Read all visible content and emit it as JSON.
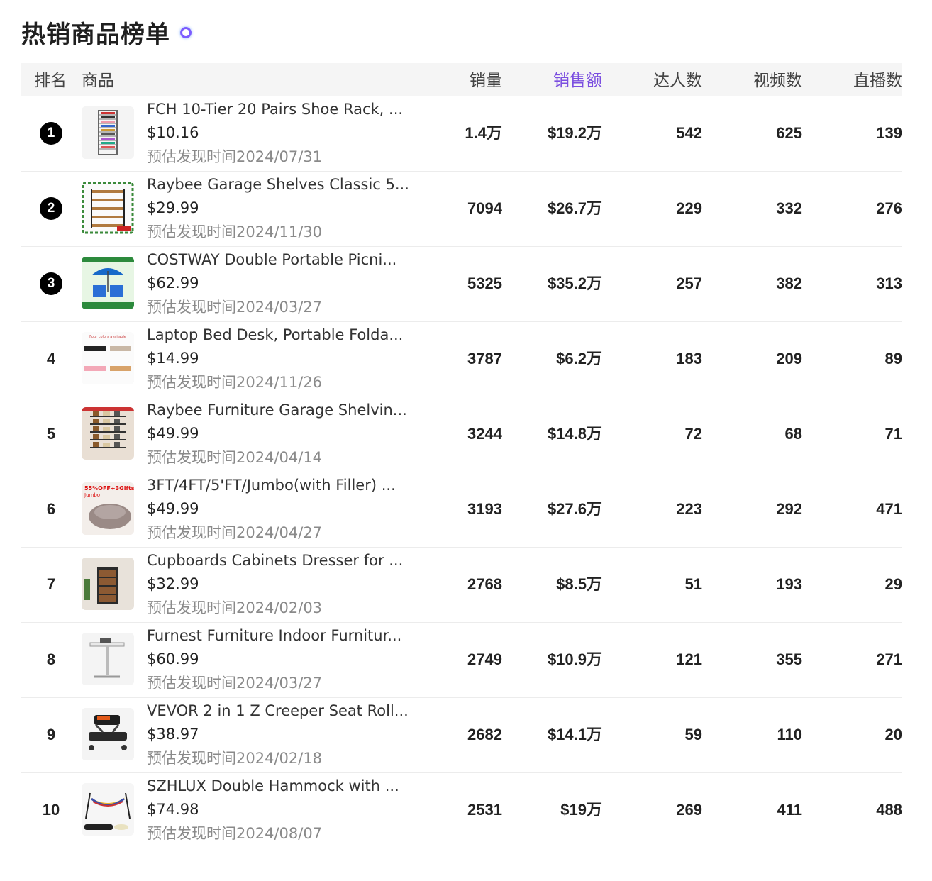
{
  "page": {
    "title": "热销商品榜单",
    "loading_icon": "spinner-icon",
    "accent_color": "#7b4fe0"
  },
  "table": {
    "headers": {
      "rank": "排名",
      "product": "商品",
      "sales": "销量",
      "revenue": "销售额",
      "creators": "达人数",
      "videos": "视频数",
      "live": "直播数"
    },
    "rows": [
      {
        "rank": "1",
        "name": "FCH 10-Tier 20 Pairs Shoe Rack, ...",
        "price": "$10.16",
        "date": "预估发现时间2024/07/31",
        "sales": "1.4万",
        "revenue": "$19.2万",
        "creators": "542",
        "videos": "625",
        "live": "139",
        "thumb": "shoe-rack-icon"
      },
      {
        "rank": "2",
        "name": "Raybee Garage Shelves Classic 5...",
        "price": "$29.99",
        "date": "预估发现时间2024/11/30",
        "sales": "7094",
        "revenue": "$26.7万",
        "creators": "229",
        "videos": "332",
        "live": "276",
        "thumb": "garage-shelf-icon"
      },
      {
        "rank": "3",
        "name": "COSTWAY Double Portable Picni...",
        "price": "$62.99",
        "date": "预估发现时间2024/03/27",
        "sales": "5325",
        "revenue": "$35.2万",
        "creators": "257",
        "videos": "382",
        "live": "313",
        "thumb": "picnic-chair-icon"
      },
      {
        "rank": "4",
        "name": "Laptop Bed Desk, Portable Folda...",
        "price": "$14.99",
        "date": "预估发现时间2024/11/26",
        "sales": "3787",
        "revenue": "$6.2万",
        "creators": "183",
        "videos": "209",
        "live": "89",
        "thumb": "laptop-desk-icon"
      },
      {
        "rank": "5",
        "name": "Raybee Furniture Garage Shelvin...",
        "price": "$49.99",
        "date": "预估发现时间2024/04/14",
        "sales": "3244",
        "revenue": "$14.8万",
        "creators": "72",
        "videos": "68",
        "live": "71",
        "thumb": "shelving-icon"
      },
      {
        "rank": "6",
        "name": "3FT/4FT/5'FT/Jumbo(with Filler) ...",
        "price": "$49.99",
        "date": "预估发现时间2024/04/27",
        "sales": "3193",
        "revenue": "$27.6万",
        "creators": "223",
        "videos": "292",
        "live": "471",
        "thumb": "bean-bag-icon"
      },
      {
        "rank": "7",
        "name": "Cupboards Cabinets Dresser for ...",
        "price": "$32.99",
        "date": "预估发现时间2024/02/03",
        "sales": "2768",
        "revenue": "$8.5万",
        "creators": "51",
        "videos": "193",
        "live": "29",
        "thumb": "dresser-icon"
      },
      {
        "rank": "8",
        "name": "Furnest Furniture Indoor Furnitur...",
        "price": "$60.99",
        "date": "预估发现时间2024/03/27",
        "sales": "2749",
        "revenue": "$10.9万",
        "creators": "121",
        "videos": "355",
        "live": "271",
        "thumb": "standing-desk-icon"
      },
      {
        "rank": "9",
        "name": "VEVOR 2 in 1 Z Creeper Seat Roll...",
        "price": "$38.97",
        "date": "预估发现时间2024/02/18",
        "sales": "2682",
        "revenue": "$14.1万",
        "creators": "59",
        "videos": "110",
        "live": "20",
        "thumb": "creeper-seat-icon"
      },
      {
        "rank": "10",
        "name": "SZHLUX Double Hammock with ...",
        "price": "$74.98",
        "date": "预估发现时间2024/08/07",
        "sales": "2531",
        "revenue": "$19万",
        "creators": "269",
        "videos": "411",
        "live": "488",
        "thumb": "hammock-icon"
      }
    ]
  }
}
